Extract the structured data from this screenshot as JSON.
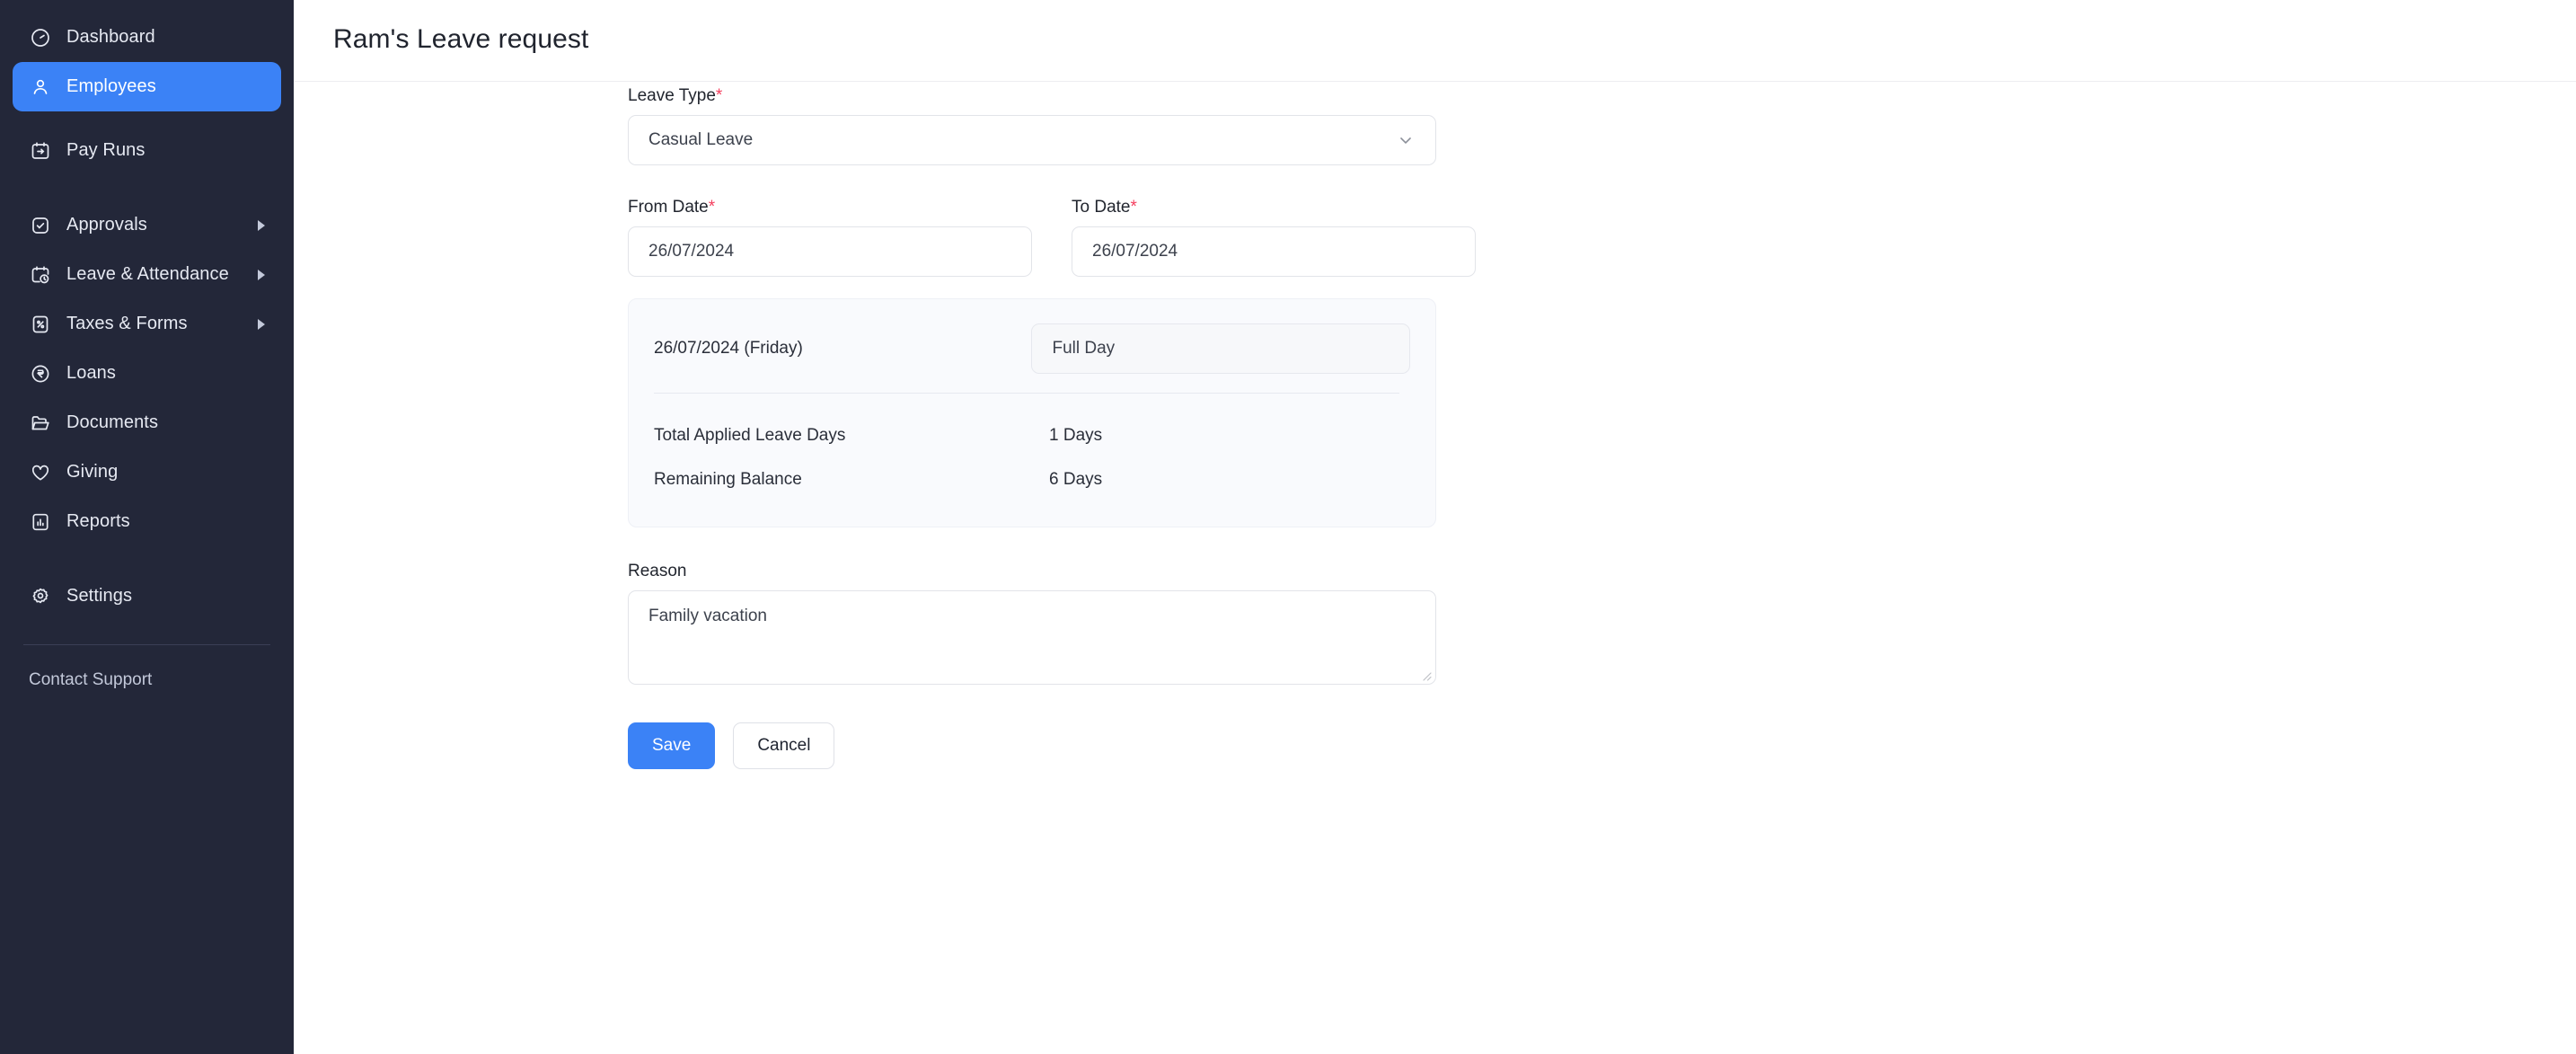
{
  "sidebar": {
    "items": [
      {
        "label": "Dashboard",
        "icon": "gauge-icon",
        "active": false,
        "expandable": false
      },
      {
        "label": "Employees",
        "icon": "user-icon",
        "active": true,
        "expandable": false
      },
      {
        "label": "Pay Runs",
        "icon": "calendar-arrow-icon",
        "active": false,
        "expandable": false
      },
      {
        "label": "Approvals",
        "icon": "check-square-icon",
        "active": false,
        "expandable": true
      },
      {
        "label": "Leave & Attendance",
        "icon": "calendar-clock-icon",
        "active": false,
        "expandable": true
      },
      {
        "label": "Taxes & Forms",
        "icon": "percent-file-icon",
        "active": false,
        "expandable": true
      },
      {
        "label": "Loans",
        "icon": "rupee-circle-icon",
        "active": false,
        "expandable": false
      },
      {
        "label": "Documents",
        "icon": "folder-icon",
        "active": false,
        "expandable": false
      },
      {
        "label": "Giving",
        "icon": "heart-icon",
        "active": false,
        "expandable": false
      },
      {
        "label": "Reports",
        "icon": "bar-chart-icon",
        "active": false,
        "expandable": false
      },
      {
        "label": "Settings",
        "icon": "gear-icon",
        "active": false,
        "expandable": false
      }
    ],
    "support_label": "Contact Support",
    "active_color": "#3b82f6",
    "background_color": "#232739"
  },
  "header": {
    "title": "Ram's Leave request"
  },
  "form": {
    "leave_type": {
      "label": "Leave Type",
      "required_mark": "*",
      "value": "Casual Leave",
      "chevron": "chevron-down-icon"
    },
    "from_date": {
      "label": "From Date",
      "required_mark": "*",
      "value": "26/07/2024"
    },
    "to_date": {
      "label": "To Date",
      "required_mark": "*",
      "value": "26/07/2024"
    },
    "day_breakdown": {
      "rows": [
        {
          "date": "26/07/2024 (Friday)",
          "duration": "Full Day"
        }
      ]
    },
    "summary": [
      {
        "key": "Total Applied Leave Days",
        "value": "1 Days"
      },
      {
        "key": "Remaining Balance",
        "value": "6 Days"
      }
    ],
    "reason": {
      "label": "Reason",
      "value": "Family vacation"
    },
    "actions": {
      "save_label": "Save",
      "cancel_label": "Cancel"
    }
  }
}
